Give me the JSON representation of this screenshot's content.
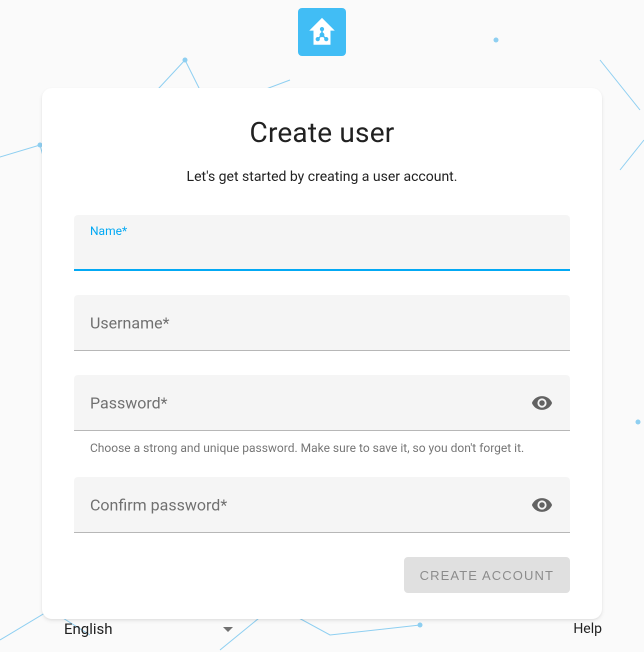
{
  "header": {
    "logo_name": "home-assistant-logo"
  },
  "card": {
    "title": "Create user",
    "subtitle": "Let's get started by creating a user account.",
    "fields": {
      "name": {
        "label": "Name*",
        "value": ""
      },
      "username": {
        "label": "Username*",
        "value": ""
      },
      "password": {
        "label": "Password*",
        "value": "",
        "helper": "Choose a strong and unique password. Make sure to save it, so you don't forget it."
      },
      "confirm_password": {
        "label": "Confirm password*",
        "value": ""
      }
    },
    "actions": {
      "create_label": "CREATE ACCOUNT"
    }
  },
  "footer": {
    "language": "English",
    "help": "Help"
  },
  "colors": {
    "accent": "#03a9f4",
    "logo_bg": "#41bdf5"
  }
}
